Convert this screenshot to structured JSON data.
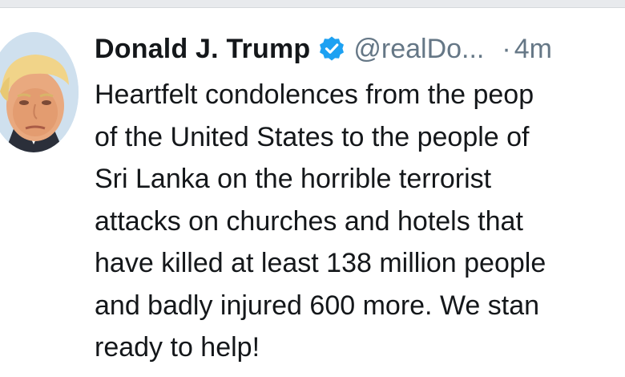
{
  "tweet": {
    "display_name": "Donald J. Trump",
    "handle": "@realDo...",
    "separator": "·",
    "time": "4m",
    "verified_icon": "verified-badge-icon",
    "text_lines": [
      "Heartfelt condolences from the peop",
      "of the United States to the people of",
      "Sri Lanka on the horrible terrorist",
      "attacks on churches and hotels that",
      "have killed at least 138 million people",
      "and badly injured 600 more. We stan",
      "ready to help!"
    ]
  },
  "colors": {
    "text": "#14171a",
    "secondary": "#657786",
    "verified_blue": "#1da1f2"
  }
}
